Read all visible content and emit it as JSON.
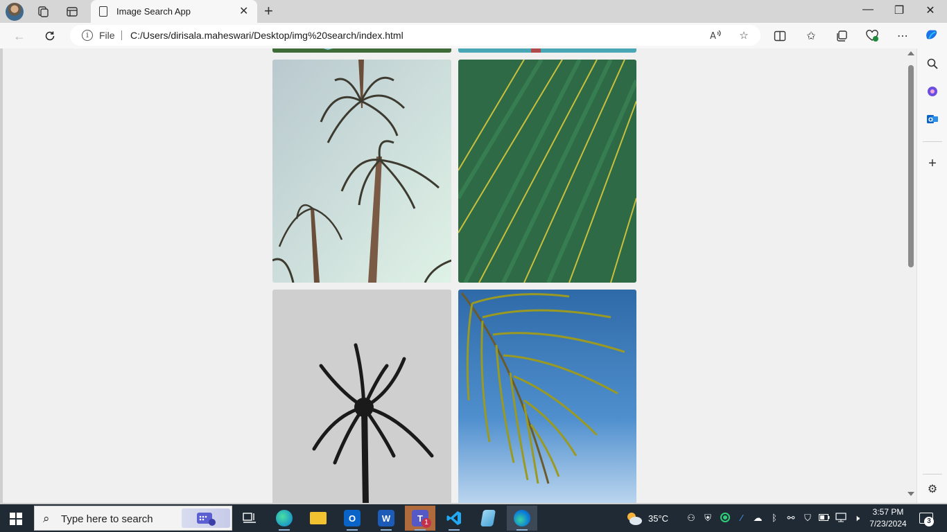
{
  "browser": {
    "tab": {
      "title": "Image Search App"
    },
    "address": {
      "scheme_label": "File",
      "url": "C:/Users/dirisala.maheswari/Desktop/img%20search/index.html"
    }
  },
  "taskbar": {
    "search_placeholder": "Type here to search",
    "weather": "35°C",
    "time": "3:57 PM",
    "date": "7/23/2024",
    "teams_badge": "1",
    "notification_count": "3"
  },
  "gallery": {
    "images": [
      {
        "subject": "palm trees from below against pale sky"
      },
      {
        "subject": "green palm leaf close-up"
      },
      {
        "subject": "black and white palm tree silhouette"
      },
      {
        "subject": "palm frond against blue sky"
      }
    ]
  },
  "colors": {
    "accent": "#0b57d0",
    "taskbar_bg": "#1f2a35",
    "page_bg": "#f0f0f0"
  }
}
